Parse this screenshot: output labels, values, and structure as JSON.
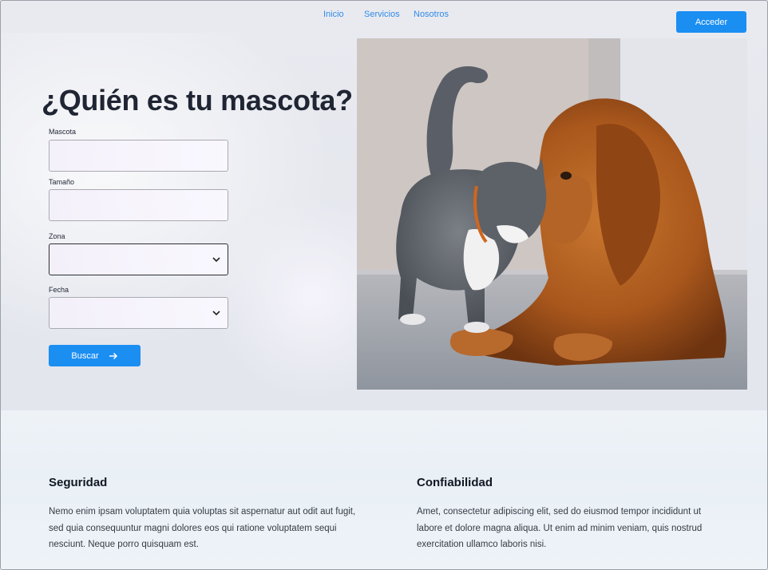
{
  "nav": {
    "links": [
      "Inicio",
      "Servicios",
      "Nosotros"
    ],
    "login_label": "Acceder"
  },
  "hero": {
    "title": "¿Quién es tu mascota?",
    "fields": {
      "pet_label": "Mascota",
      "size_label": "Tamaño",
      "zone_label": "Zona",
      "date_label": "Fecha"
    },
    "search_label": "Buscar",
    "image_alt": "gato-y-perro"
  },
  "features": [
    {
      "title": "Seguridad",
      "text": "Nemo enim ipsam voluptatem quia voluptas sit aspernatur aut odit aut fugit, sed quia consequuntur magni dolores eos qui ratione voluptatem sequi nesciunt. Neque porro quisquam est."
    },
    {
      "title": "Confiabilidad",
      "text": "Amet, consectetur adipiscing elit, sed do eiusmod tempor incididunt ut labore et dolore magna aliqua. Ut enim ad minim veniam, quis nostrud exercitation ullamco laboris nisi."
    }
  ],
  "colors": {
    "accent": "#1b8ef2",
    "nav_link": "#2f8be6",
    "title": "#1f2533"
  }
}
